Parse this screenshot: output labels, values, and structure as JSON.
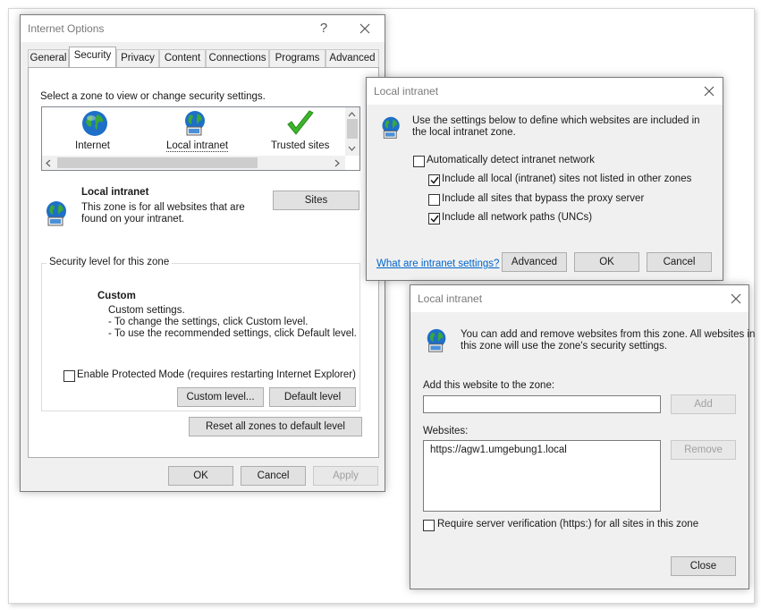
{
  "internet_options": {
    "title": "Internet Options",
    "help": "?",
    "tabs": [
      {
        "label": "General"
      },
      {
        "label": "Security"
      },
      {
        "label": "Privacy"
      },
      {
        "label": "Content"
      },
      {
        "label": "Connections"
      },
      {
        "label": "Programs"
      },
      {
        "label": "Advanced"
      }
    ],
    "zone_prompt": "Select a zone to view or change security settings.",
    "zones": [
      {
        "label": "Internet",
        "icon": "globe-icon"
      },
      {
        "label": "Local intranet",
        "icon": "intranet-icon"
      },
      {
        "label": "Trusted sites",
        "icon": "checkmark-icon"
      }
    ],
    "zone_title": "Local intranet",
    "zone_desc_1": "This zone is for all websites that are",
    "zone_desc_2": "found on your intranet.",
    "sites_button": "Sites",
    "security_level_legend": "Security level for this zone",
    "custom_title": "Custom",
    "custom_line1": "Custom settings.",
    "custom_line2": "- To change the settings, click Custom level.",
    "custom_line3": "- To use the recommended settings, click Default level.",
    "protected_mode_label": "Enable Protected Mode (requires restarting Internet Explorer)",
    "protected_mode_checked": false,
    "custom_level_button": "Custom level...",
    "default_level_button": "Default level",
    "reset_button": "Reset all zones to default level",
    "ok_button": "OK",
    "cancel_button": "Cancel",
    "apply_button": "Apply"
  },
  "intranet_dialog": {
    "title": "Local intranet",
    "description_line1": "Use the settings below to define which websites are included in",
    "description_line2": "the local intranet zone.",
    "auto_detect_label": "Automatically detect intranet network",
    "auto_detect_checked": false,
    "include_local_label": "Include all local (intranet) sites not listed in other zones",
    "include_local_checked": true,
    "include_bypass_label": "Include all sites that bypass the proxy server",
    "include_bypass_checked": false,
    "include_unc_label": "Include all network paths (UNCs)",
    "include_unc_checked": true,
    "help_link": "What are intranet settings?",
    "advanced_button": "Advanced",
    "ok_button": "OK",
    "cancel_button": "Cancel"
  },
  "sites_dialog": {
    "title": "Local intranet",
    "description_line1": "You can add and remove websites from this zone. All websites in",
    "description_line2": "this zone will use the zone's security settings.",
    "add_label": "Add this website to the zone:",
    "add_input_value": "",
    "add_button": "Add",
    "websites_label": "Websites:",
    "websites": [
      "https://agw1.umgebung1.local"
    ],
    "remove_button": "Remove",
    "https_label": "Require server verification (https:) for all sites in this zone",
    "https_checked": false,
    "close_button": "Close"
  },
  "colors": {
    "link": "#0066cc",
    "dialog_bg": "#f0f0f0",
    "check_green": "#3cb52a",
    "globe_blue": "#1e6fc8"
  }
}
